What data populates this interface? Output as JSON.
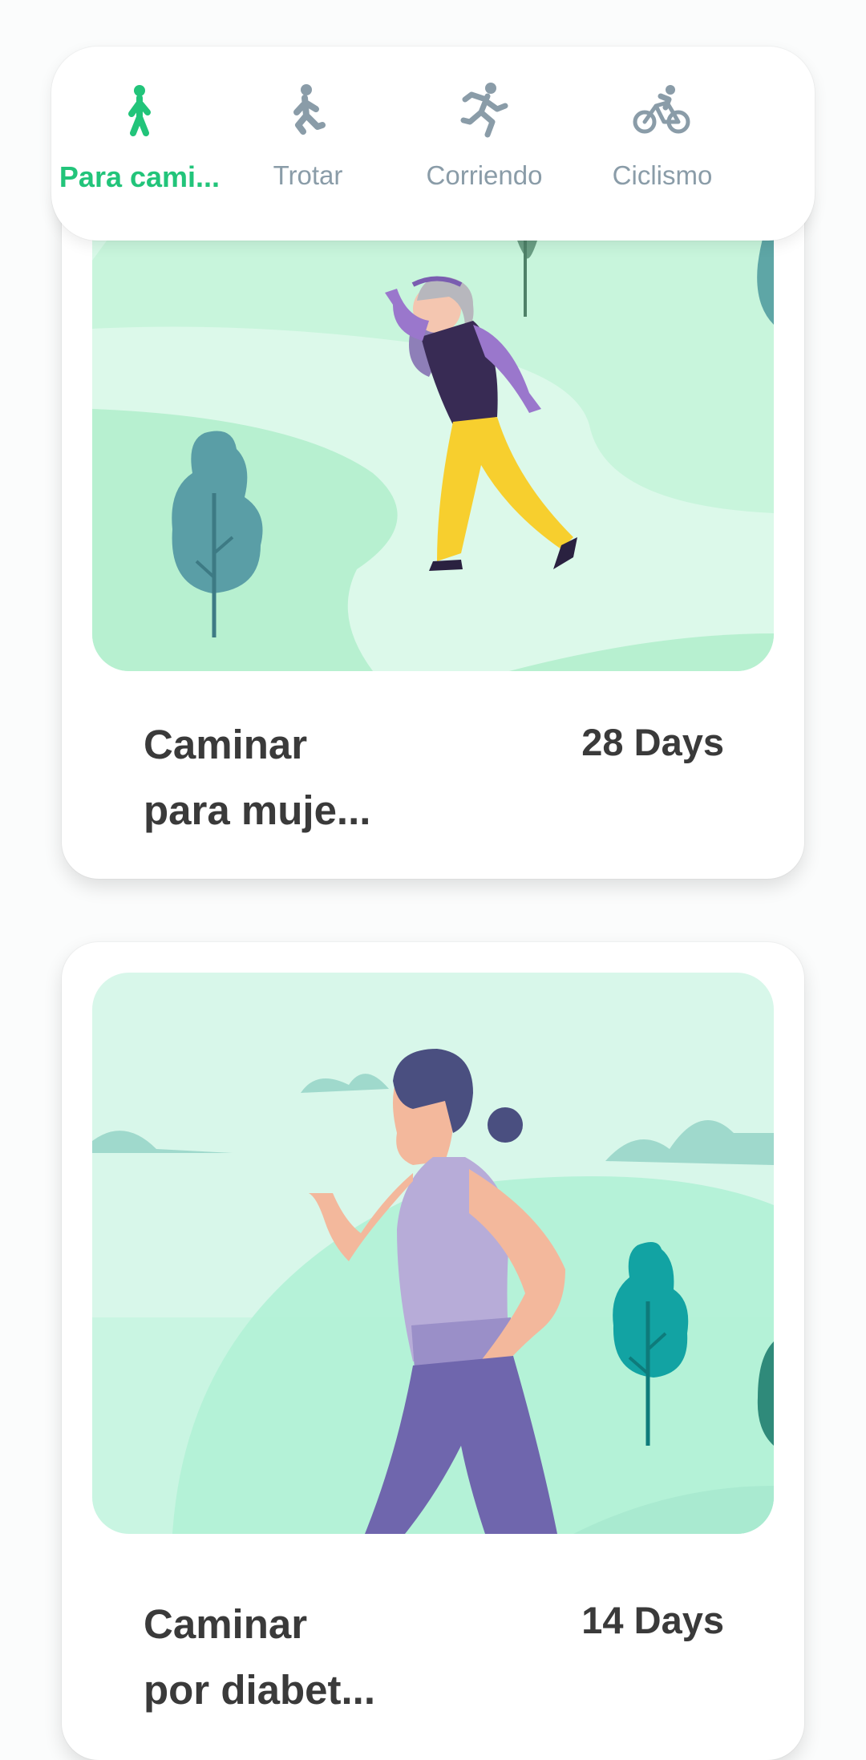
{
  "tabs": [
    {
      "label": "Para cami...",
      "icon": "walking-icon",
      "active": true
    },
    {
      "label": "Trotar",
      "icon": "jogging-icon",
      "active": false
    },
    {
      "label": "Corriendo",
      "icon": "running-icon",
      "active": false
    },
    {
      "label": "Ciclismo",
      "icon": "cycling-icon",
      "active": false
    }
  ],
  "colors": {
    "accent": "#22c47a",
    "inactive": "#8a9ca8"
  },
  "plans": [
    {
      "title_line1": "Caminar",
      "title_line2": "para muje...",
      "duration": "28 Days"
    },
    {
      "title_line1": "Caminar",
      "title_line2": "por diabet...",
      "duration": "14 Days"
    }
  ]
}
